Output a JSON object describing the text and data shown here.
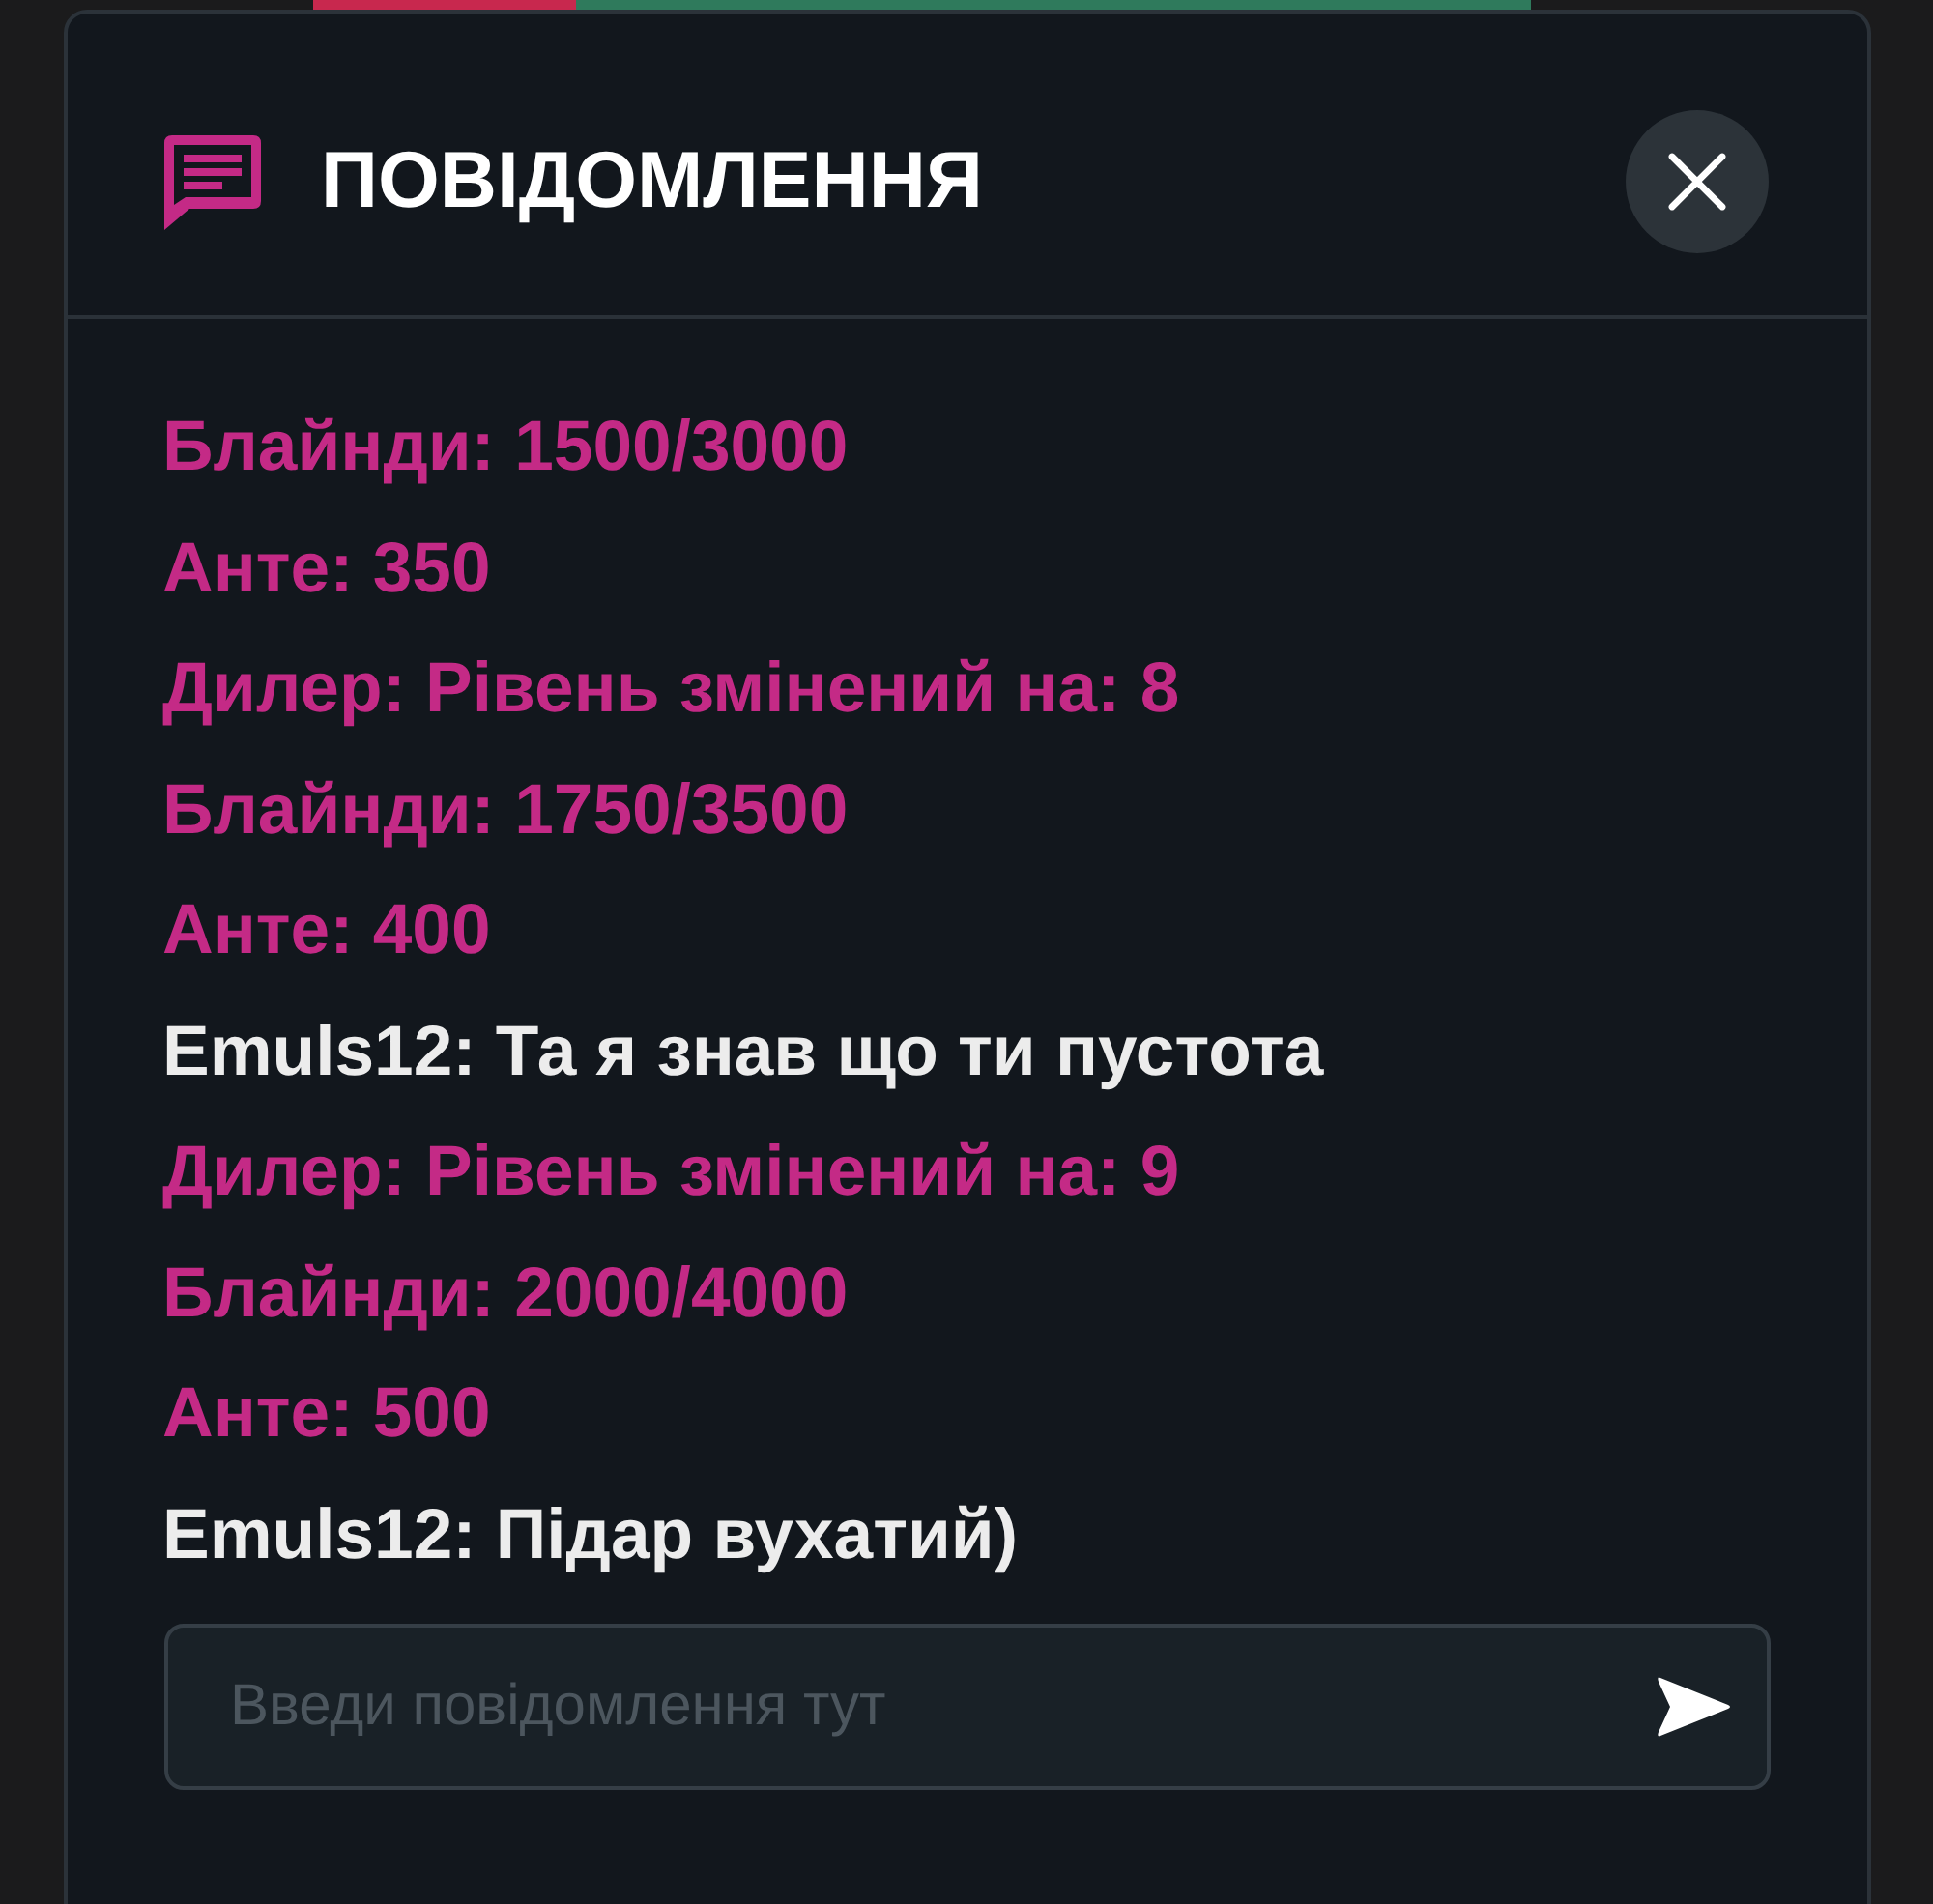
{
  "header": {
    "title": "ПОВІДОМЛЕННЯ"
  },
  "messages": [
    {
      "kind": "system",
      "text": "Блайнди: 1500/3000"
    },
    {
      "kind": "system",
      "text": "Анте: 350"
    },
    {
      "kind": "system",
      "text": "Дилер: Рівень змінений на: 8"
    },
    {
      "kind": "system",
      "text": "Блайнди: 1750/3500"
    },
    {
      "kind": "system",
      "text": "Анте: 400"
    },
    {
      "kind": "chat",
      "text": "Emuls12: Та я знав що ти пустота"
    },
    {
      "kind": "system",
      "text": "Дилер: Рівень змінений на: 9"
    },
    {
      "kind": "system",
      "text": "Блайнди: 2000/4000"
    },
    {
      "kind": "system",
      "text": "Анте: 500"
    },
    {
      "kind": "chat",
      "text": "Emuls12: Підар вухатий)"
    }
  ],
  "composer": {
    "placeholder": "Введи повідомлення тут"
  }
}
